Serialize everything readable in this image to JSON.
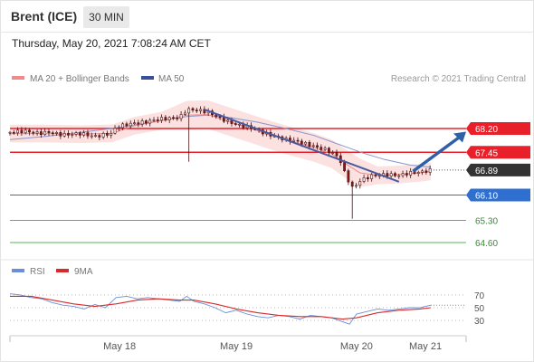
{
  "header": {
    "title": "Brent (ICE)",
    "timeframe": "30 MIN"
  },
  "timestamp": "Thursday, May 20, 2021 7:08:24 AM CET",
  "legend": {
    "bollinger": "MA 20 + Bollinger Bands",
    "ma50": "MA 50",
    "copyright": "Research © 2021 Trading Central",
    "rsi": "RSI",
    "rsi_ma": "9MA"
  },
  "colors": {
    "bollinger": "#f08b8b",
    "band_fill": "#fcdede",
    "ma50": "#8a96c8",
    "resistance": "#e8202a",
    "current": "#333333",
    "pivot": "#2e6fd0",
    "support": "#59b359",
    "trendline": "#4a5aa0",
    "arrow": "#2e5fa8",
    "rsi": "#6a8fd8",
    "rsi_ma": "#d92a2a"
  },
  "chart_data": [
    {
      "type": "candlestick",
      "x_labels": [
        "May 18",
        "May 19",
        "May 20",
        "May 21"
      ],
      "ylim": [
        64.2,
        69.4
      ],
      "levels": [
        {
          "value": 68.2,
          "label": "68.20",
          "kind": "resistance"
        },
        {
          "value": 67.45,
          "label": "67.45",
          "kind": "resistance"
        },
        {
          "value": 66.89,
          "label": "66.89",
          "kind": "current"
        },
        {
          "value": 66.1,
          "label": "66.10",
          "kind": "pivot"
        },
        {
          "value": 65.3,
          "label": "65.30",
          "kind": "support"
        },
        {
          "value": 64.6,
          "label": "64.60",
          "kind": "support"
        }
      ],
      "close_path": [
        [
          0,
          68.08
        ],
        [
          8,
          68.12
        ],
        [
          16,
          68.05
        ],
        [
          22,
          68.08
        ],
        [
          30,
          68.0
        ],
        [
          40,
          68.04
        ],
        [
          48,
          67.95
        ],
        [
          58,
          68.05
        ],
        [
          60,
          68.25
        ],
        [
          68,
          68.35
        ],
        [
          76,
          68.4
        ],
        [
          84,
          68.5
        ],
        [
          90,
          68.52
        ],
        [
          96,
          68.55
        ],
        [
          100,
          68.8
        ],
        [
          106,
          68.78
        ],
        [
          112,
          68.72
        ],
        [
          118,
          68.55
        ],
        [
          124,
          68.4
        ],
        [
          130,
          68.3
        ],
        [
          138,
          68.2
        ],
        [
          144,
          68.05
        ],
        [
          150,
          67.95
        ],
        [
          156,
          67.85
        ],
        [
          162,
          67.8
        ],
        [
          168,
          67.7
        ],
        [
          174,
          67.6
        ],
        [
          180,
          67.5
        ],
        [
          186,
          67.3
        ],
        [
          190,
          66.7
        ],
        [
          194,
          66.3
        ],
        [
          198,
          66.55
        ],
        [
          204,
          66.7
        ],
        [
          212,
          66.75
        ],
        [
          220,
          66.72
        ],
        [
          226,
          66.8
        ],
        [
          232,
          66.82
        ],
        [
          238,
          66.89
        ]
      ],
      "ma20": [
        [
          0,
          68.04
        ],
        [
          20,
          68.04
        ],
        [
          40,
          68.02
        ],
        [
          58,
          68.05
        ],
        [
          70,
          68.28
        ],
        [
          86,
          68.45
        ],
        [
          100,
          68.62
        ],
        [
          112,
          68.64
        ],
        [
          124,
          68.42
        ],
        [
          136,
          68.2
        ],
        [
          148,
          67.98
        ],
        [
          160,
          67.78
        ],
        [
          172,
          67.6
        ],
        [
          182,
          67.4
        ],
        [
          190,
          67.08
        ],
        [
          198,
          66.8
        ],
        [
          208,
          66.72
        ],
        [
          220,
          66.75
        ],
        [
          232,
          66.8
        ],
        [
          238,
          66.85
        ]
      ],
      "ma50": [
        [
          0,
          67.85
        ],
        [
          20,
          67.95
        ],
        [
          40,
          68.08
        ],
        [
          60,
          68.22
        ],
        [
          80,
          68.4
        ],
        [
          100,
          68.58
        ],
        [
          112,
          68.62
        ],
        [
          124,
          68.55
        ],
        [
          140,
          68.4
        ],
        [
          156,
          68.2
        ],
        [
          172,
          67.98
        ],
        [
          186,
          67.7
        ],
        [
          200,
          67.42
        ],
        [
          212,
          67.22
        ],
        [
          226,
          67.05
        ],
        [
          238,
          66.98
        ]
      ],
      "trendline": [
        [
          110,
          68.8
        ],
        [
          220,
          66.52
        ]
      ],
      "forecast_arrow": [
        [
          228,
          66.85
        ],
        [
          258,
          68.1
        ]
      ],
      "dotted_projection": [
        [
          238,
          66.89
        ],
        [
          254,
          66.89
        ]
      ]
    },
    {
      "type": "line",
      "title": "RSI",
      "yticks": [
        70,
        50,
        30
      ],
      "ylim": [
        10,
        90
      ],
      "series": [
        {
          "name": "RSI",
          "points": [
            [
              0,
              72
            ],
            [
              6,
              70
            ],
            [
              12,
              66
            ],
            [
              18,
              64
            ],
            [
              24,
              58
            ],
            [
              30,
              54
            ],
            [
              36,
              52
            ],
            [
              42,
              48
            ],
            [
              48,
              55
            ],
            [
              54,
              50
            ],
            [
              60,
              66
            ],
            [
              66,
              68
            ],
            [
              72,
              64
            ],
            [
              78,
              66
            ],
            [
              84,
              64
            ],
            [
              90,
              62
            ],
            [
              96,
              60
            ],
            [
              100,
              68
            ],
            [
              104,
              60
            ],
            [
              110,
              56
            ],
            [
              116,
              50
            ],
            [
              122,
              42
            ],
            [
              128,
              46
            ],
            [
              134,
              40
            ],
            [
              140,
              36
            ],
            [
              146,
              34
            ],
            [
              152,
              38
            ],
            [
              158,
              36
            ],
            [
              164,
              32
            ],
            [
              170,
              38
            ],
            [
              176,
              36
            ],
            [
              182,
              34
            ],
            [
              188,
              28
            ],
            [
              192,
              24
            ],
            [
              196,
              40
            ],
            [
              202,
              44
            ],
            [
              208,
              48
            ],
            [
              214,
              46
            ],
            [
              220,
              48
            ],
            [
              226,
              50
            ],
            [
              232,
              50
            ],
            [
              238,
              54
            ]
          ]
        },
        {
          "name": "9MA",
          "points": [
            [
              0,
              68
            ],
            [
              12,
              68
            ],
            [
              24,
              62
            ],
            [
              36,
              56
            ],
            [
              48,
              52
            ],
            [
              60,
              56
            ],
            [
              72,
              62
            ],
            [
              84,
              64
            ],
            [
              96,
              62
            ],
            [
              104,
              62
            ],
            [
              116,
              56
            ],
            [
              128,
              48
            ],
            [
              140,
              42
            ],
            [
              152,
              38
            ],
            [
              164,
              36
            ],
            [
              176,
              36
            ],
            [
              188,
              32
            ],
            [
              196,
              34
            ],
            [
              208,
              42
            ],
            [
              220,
              46
            ],
            [
              232,
              48
            ],
            [
              238,
              50
            ]
          ]
        }
      ]
    }
  ]
}
